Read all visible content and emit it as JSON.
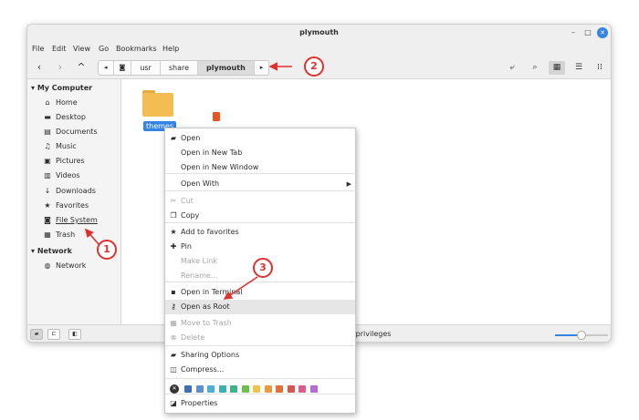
{
  "window": {
    "title": "plymouth"
  },
  "menubar": {
    "items": [
      "File",
      "Edit",
      "View",
      "Go",
      "Bookmarks",
      "Help"
    ]
  },
  "breadcrumbs": {
    "items": [
      "usr",
      "share",
      "plymouth"
    ]
  },
  "sidebar": {
    "my_computer": "My Computer",
    "computer_items": [
      {
        "label": "Home",
        "icon": "home-icon",
        "glyph": "⌂"
      },
      {
        "label": "Desktop",
        "icon": "desktop-icon",
        "glyph": "▬"
      },
      {
        "label": "Documents",
        "icon": "documents-icon",
        "glyph": "▤"
      },
      {
        "label": "Music",
        "icon": "music-icon",
        "glyph": "♫"
      },
      {
        "label": "Pictures",
        "icon": "pictures-icon",
        "glyph": "▣"
      },
      {
        "label": "Videos",
        "icon": "videos-icon",
        "glyph": "▥"
      },
      {
        "label": "Downloads",
        "icon": "downloads-icon",
        "glyph": "↓"
      },
      {
        "label": "Favorites",
        "icon": "star-icon",
        "glyph": "★"
      },
      {
        "label": "File System",
        "icon": "drive-icon",
        "glyph": "◙"
      },
      {
        "label": "Trash",
        "icon": "trash-icon",
        "glyph": "▦"
      }
    ],
    "network": "Network",
    "network_items": [
      {
        "label": "Network",
        "icon": "network-icon",
        "glyph": "◍"
      }
    ]
  },
  "content": {
    "folder_label": "themes"
  },
  "statusbar": {
    "text": "n privileges",
    "zoom_fraction": 0.5
  },
  "context_menu": {
    "items": [
      {
        "label": "Open",
        "icon": "folder-open-icon",
        "glyph": "▰",
        "disabled": false
      },
      {
        "label": "Open in New Tab",
        "icon": "",
        "glyph": "",
        "disabled": false
      },
      {
        "label": "Open in New Window",
        "icon": "",
        "glyph": "",
        "disabled": false
      },
      {
        "label": "Open With",
        "icon": "",
        "glyph": "",
        "disabled": false,
        "submenu": true
      },
      {
        "label": "Cut",
        "icon": "scissors-icon",
        "glyph": "✂",
        "disabled": true
      },
      {
        "label": "Copy",
        "icon": "copy-icon",
        "glyph": "❐",
        "disabled": false
      },
      {
        "label": "Add to favorites",
        "icon": "star-plus-icon",
        "glyph": "★",
        "disabled": false
      },
      {
        "label": "Pin",
        "icon": "pin-icon",
        "glyph": "✚",
        "disabled": false
      },
      {
        "label": "Make Link",
        "icon": "",
        "glyph": "",
        "disabled": true
      },
      {
        "label": "Rename...",
        "icon": "",
        "glyph": "",
        "disabled": true
      },
      {
        "label": "Open in Terminal",
        "icon": "terminal-icon",
        "glyph": "▪",
        "disabled": false
      },
      {
        "label": "Open as Root",
        "icon": "key-icon",
        "glyph": "⚷",
        "disabled": false,
        "highlighted": true
      },
      {
        "label": "Move to Trash",
        "icon": "trash-icon",
        "glyph": "▦",
        "disabled": true
      },
      {
        "label": "Delete",
        "icon": "delete-icon",
        "glyph": "⊗",
        "disabled": true
      },
      {
        "label": "Sharing Options",
        "icon": "share-folder-icon",
        "glyph": "▰",
        "disabled": false
      },
      {
        "label": "Compress...",
        "icon": "archive-icon",
        "glyph": "◫",
        "disabled": false
      },
      {
        "label": "Properties",
        "icon": "properties-icon",
        "glyph": "◪",
        "disabled": false
      }
    ],
    "colors": [
      "#3d6fb6",
      "#5b8fd0",
      "#4ab0d9",
      "#3fb0b0",
      "#3bb48b",
      "#6cbf4d",
      "#f0c34c",
      "#e89a3c",
      "#e0703c",
      "#d9534f",
      "#e05a8a",
      "#b36cd0"
    ]
  },
  "callouts": [
    "1",
    "2",
    "3"
  ],
  "colors": {
    "accent": "#3584e4",
    "annotation": "#e0312e"
  }
}
